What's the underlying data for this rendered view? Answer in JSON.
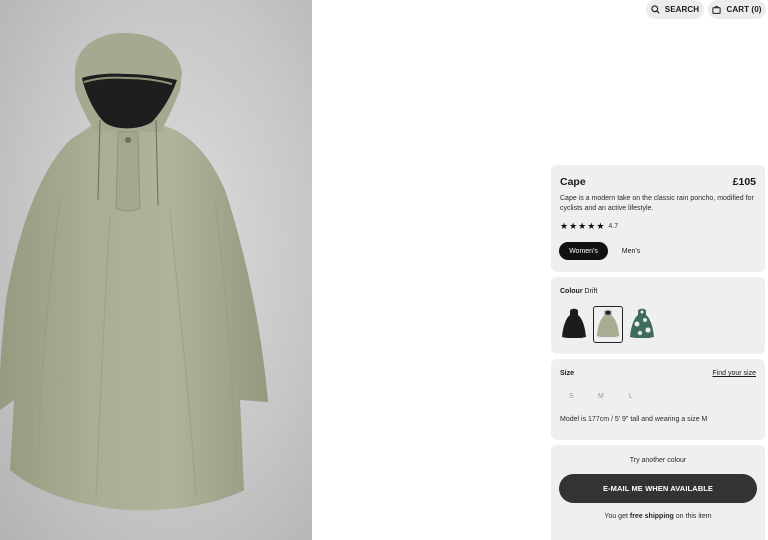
{
  "header": {
    "search_label": "SEARCH",
    "cart_label": "CART (0)"
  },
  "product": {
    "name": "Cape",
    "price": "£105",
    "description": "Cape is a modern take on the classic rain poncho, modified for cyclists and an active lifestyle.",
    "rating": 4.7,
    "rating_text": "4.7",
    "stars": 5,
    "genders": [
      "Women's",
      "Men's"
    ],
    "selected_gender": "Women's"
  },
  "colour": {
    "label": "Colour",
    "selected": "Drift",
    "swatches": [
      {
        "name": "black",
        "color": "#1c1c1c"
      },
      {
        "name": "drift",
        "color": "#a7ac92",
        "selected": true
      },
      {
        "name": "camo",
        "color": "#3f6b5c"
      }
    ]
  },
  "size": {
    "label": "Size",
    "find_link": "Find your size",
    "options": [
      "S",
      "M",
      "L"
    ],
    "model_info": "Model is 177cm / 5' 9\" tall and wearing a size M"
  },
  "availability": {
    "try_colour": "Try another colour",
    "email_button": "E-MAIL ME WHEN AVAILABLE",
    "shipping_prefix": "You get",
    "shipping_bold": "free shipping",
    "shipping_suffix": "on this item"
  },
  "colors": {
    "product": "#a7ac92",
    "panel_bg": "#efefef",
    "button_dark": "#333333"
  }
}
